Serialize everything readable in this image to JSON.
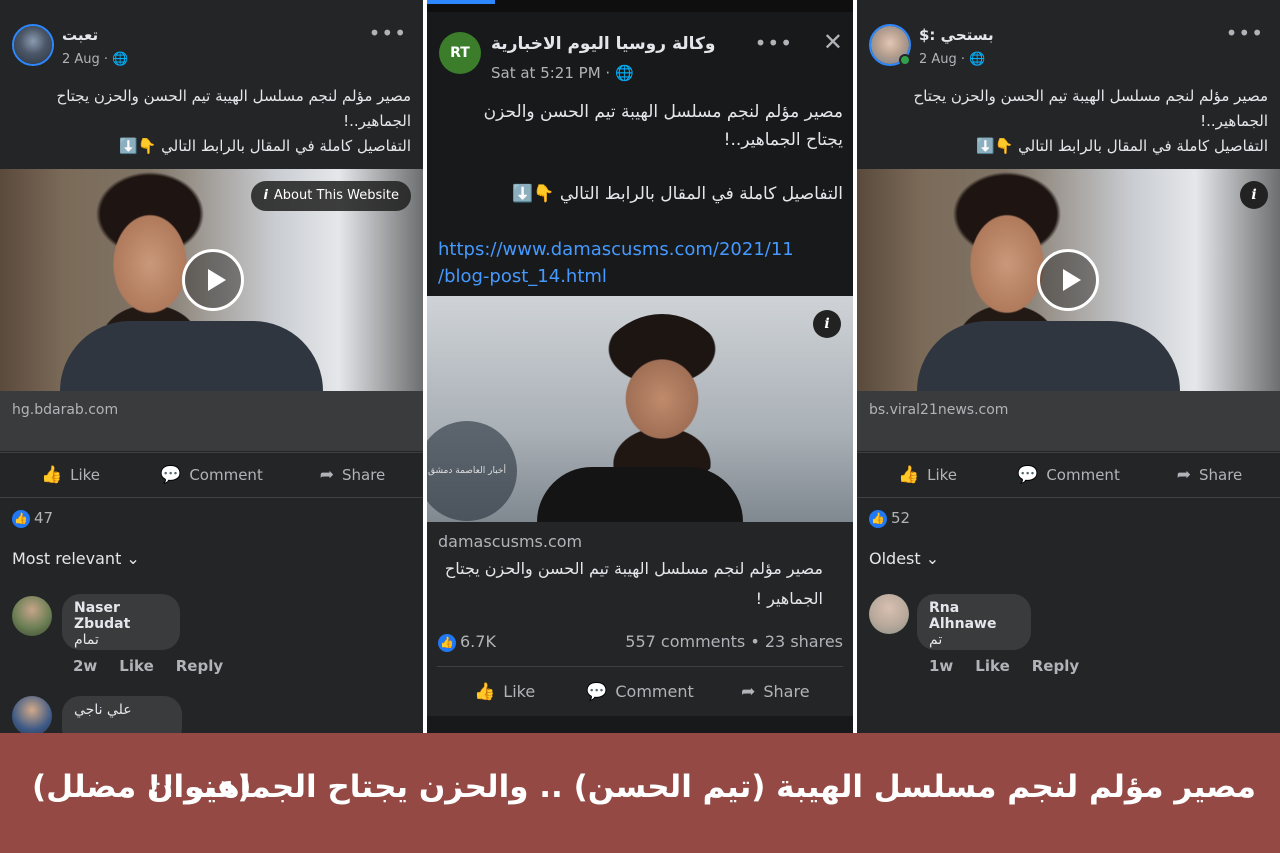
{
  "left": {
    "author": "تعبت",
    "time": "2 Aug · 🌐",
    "menu": "•••",
    "text_line1": "مصير مؤلم لنجم مسلسل الهيبة تيم الحسن والحزن يجتاح",
    "text_line2": "الجماهير..!",
    "text_line3": "التفاصيل كاملة في المقال بالرابط التالي 👇⬇️",
    "about": "About This Website",
    "domain": "hg.bdarab.com",
    "like": "Like",
    "comment": "Comment",
    "share": "Share",
    "reactions": "47",
    "sort": "Most relevant ⌄",
    "comment1_name": "Naser Zbudat",
    "comment1_text": "تمام",
    "comment1_age": "2w",
    "comment1_like": "Like",
    "comment1_reply": "Reply",
    "comment2_name": "علي ناجي"
  },
  "middle": {
    "author": "وكالة روسيا اليوم الاخبارية",
    "time": "Sat at 5:21 PM · 🌐",
    "menu": "•••",
    "close": "✕",
    "logo": "RT",
    "text_line1": "مصير مؤلم لنجم مسلسل الهيبة تيم الحسن والحزن",
    "text_line2": "يجتاح الجماهير..!",
    "text_line3": "التفاصيل كاملة في المقال بالرابط التالي 👇⬇️",
    "link_line1": "https://www.damascusms.com/2021/11",
    "link_line2": "/blog-post_14.html",
    "watermark": "أخبار العاصمة دمشق",
    "domain": "damascusms.com",
    "card_title_line1": "مصير مؤلم لنجم مسلسل الهيبة تيم الحسن والحزن يجتاح",
    "card_title_line2": "الجماهير !",
    "reactions": "6.7K",
    "stats": "557 comments • 23 shares",
    "like": "Like",
    "comment": "Comment",
    "share": "Share"
  },
  "right": {
    "author": "بستحي :$",
    "time": "2 Aug · 🌐",
    "menu": "•••",
    "text_line1": "مصير مؤلم لنجم مسلسل الهيبة تيم الحسن والحزن يجتاح",
    "text_line2": "الجماهير..!",
    "text_line3": "التفاصيل كاملة في المقال بالرابط التالي 👇⬇️",
    "domain": "bs.viral21news.com",
    "like": "Like",
    "comment": "Comment",
    "share": "Share",
    "reactions": "52",
    "sort": "Oldest ⌄",
    "comment1_name": "Rna Alhnawe",
    "comment1_text": "تم",
    "comment1_age": "1w",
    "comment1_like": "Like",
    "comment1_reply": "Reply"
  },
  "banner": {
    "headline": "مصير مؤلم لنجم مسلسل الهيبة (تيم الحسن) .. والحزن يجتاح الجماهير !!",
    "tag": "(عنوان مضلل)"
  },
  "icons": {
    "like": "👍",
    "comment": "💬",
    "share": "➦",
    "info": "i"
  },
  "colors": {
    "fb_dark": "#242526",
    "link_blue": "#4599ff",
    "banner_red": "#944944"
  }
}
